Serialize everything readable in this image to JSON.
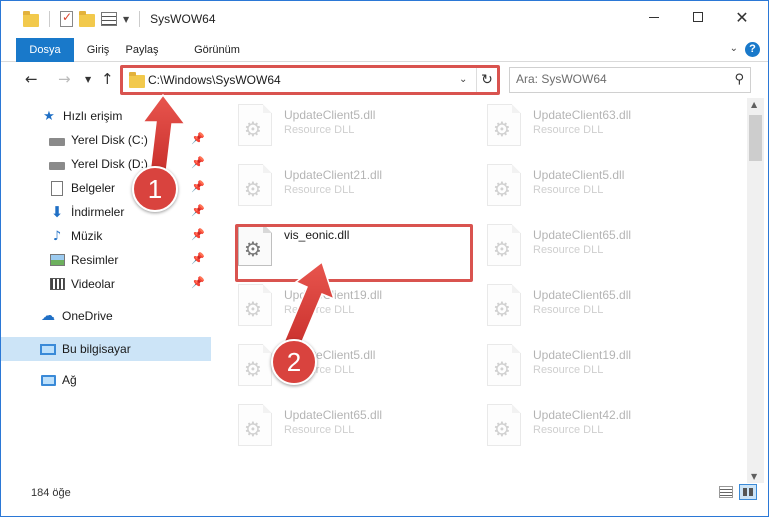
{
  "window": {
    "title": "SysWOW64"
  },
  "ribbon": {
    "tabs": [
      "Dosya",
      "Giriş",
      "Paylaş",
      "Görünüm"
    ],
    "help": "?"
  },
  "navigation": {
    "address": "C:\\Windows\\SysWOW64",
    "search_placeholder": "Ara: SysWOW64"
  },
  "sidebar": {
    "items": [
      {
        "label": "Hızlı erişim",
        "icon": "star-icon"
      },
      {
        "label": "Yerel Disk (C:)",
        "icon": "drive-icon"
      },
      {
        "label": "Yerel Disk (D:)",
        "icon": "drive-icon"
      },
      {
        "label": "Belgeler",
        "icon": "document-icon"
      },
      {
        "label": "İndirmeler",
        "icon": "download-icon"
      },
      {
        "label": "Müzik",
        "icon": "music-icon"
      },
      {
        "label": "Resimler",
        "icon": "pictures-icon"
      },
      {
        "label": "Videolar",
        "icon": "videos-icon"
      },
      {
        "label": "OneDrive",
        "icon": "cloud-icon"
      },
      {
        "label": "Bu bilgisayar",
        "icon": "computer-icon"
      },
      {
        "label": "Ağ",
        "icon": "network-icon"
      }
    ]
  },
  "files": [
    {
      "name": "UpdateClient5.dll",
      "type": "Resource DLL"
    },
    {
      "name": "UpdateClient63.dll",
      "type": "Resource DLL"
    },
    {
      "name": "UpdateClient21.dll",
      "type": "Resource DLL"
    },
    {
      "name": "UpdateClient5.dll",
      "type": "Resource DLL"
    },
    {
      "name": "vis_eonic.dll",
      "type": ""
    },
    {
      "name": "UpdateClient65.dll",
      "type": "Resource DLL"
    },
    {
      "name": "UpdateClient19.dll",
      "type": "Resource DLL"
    },
    {
      "name": "UpdateClient65.dll",
      "type": "Resource DLL"
    },
    {
      "name": "UpdateClient5.dll",
      "type": "Resource DLL"
    },
    {
      "name": "UpdateClient19.dll",
      "type": "Resource DLL"
    },
    {
      "name": "UpdateClient65.dll",
      "type": "Resource DLL"
    },
    {
      "name": "UpdateClient42.dll",
      "type": "Resource DLL"
    }
  ],
  "status": {
    "item_count": "184 öğe"
  },
  "callouts": [
    "1",
    "2"
  ],
  "colors": {
    "accent": "#1979ca",
    "highlight": "#d9534f",
    "selection": "#cce4f7"
  }
}
